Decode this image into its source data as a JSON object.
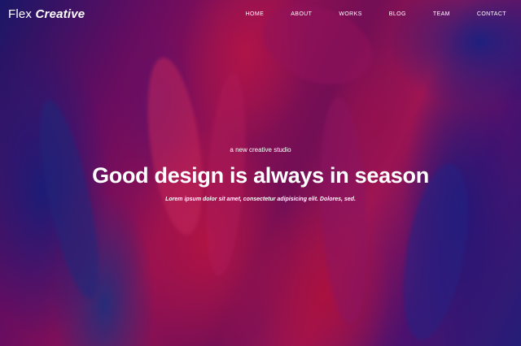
{
  "brand": {
    "light": "Flex",
    "bold": "Creative"
  },
  "nav": {
    "items": [
      "HOME",
      "ABOUT",
      "WORKS",
      "BLOG",
      "TEAM",
      "CONTACT"
    ]
  },
  "hero": {
    "eyebrow": "a new creative studio",
    "headline": "Good design is always in season",
    "subtitle": "Lorem ipsum dolor sit amet, consectetur adipisicing elit. Dolores, sed."
  },
  "colors": {
    "text": "#ffffff",
    "magenta": "#c01a60",
    "blue": "#1e1c78"
  }
}
